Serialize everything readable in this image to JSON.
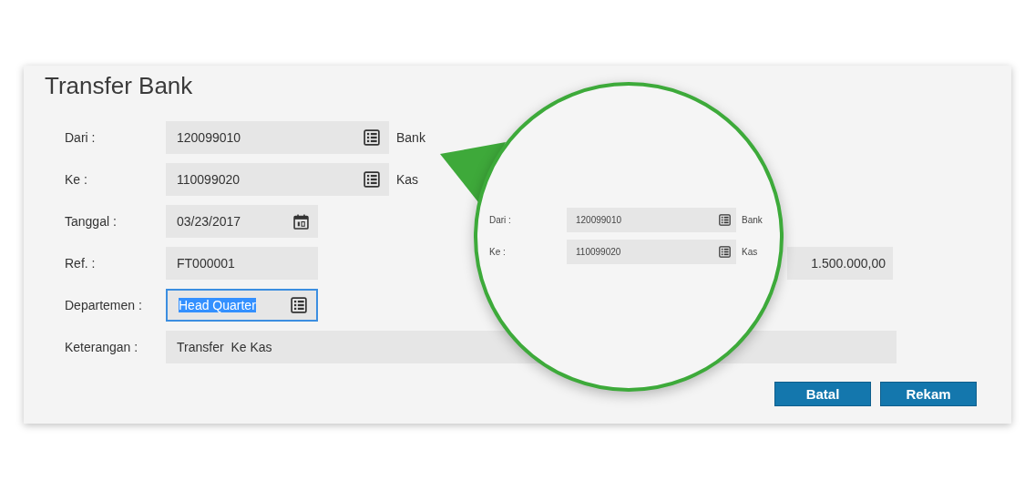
{
  "title": "Transfer Bank",
  "fields": [
    {
      "label": "Dari :",
      "value": "120099010",
      "kind": "lookup",
      "note": "Bank",
      "focused": false
    },
    {
      "label": "Ke :",
      "value": "110099020",
      "kind": "lookup",
      "note": "Kas",
      "focused": false
    },
    {
      "label": "Tanggal :",
      "value": "03/23/2017",
      "kind": "date",
      "focused": false
    },
    {
      "label": "Ref. :",
      "value": "FT000001",
      "kind": "text",
      "side_value": "1.500.000,00",
      "focused": false
    },
    {
      "label": "Departemen :",
      "value": "Head Quarter",
      "kind": "lookup",
      "focused": true
    },
    {
      "label": "Keterangan :",
      "value": "Transfer  Ke Kas",
      "kind": "memo",
      "focused": false
    }
  ],
  "magnifier": {
    "rows": [
      {
        "label": "Dari :",
        "value": "120099010",
        "note": "Bank"
      },
      {
        "label": "Ke :",
        "value": "110099020",
        "note": "Kas"
      }
    ]
  },
  "buttons": [
    "Batal",
    "Rekam"
  ]
}
